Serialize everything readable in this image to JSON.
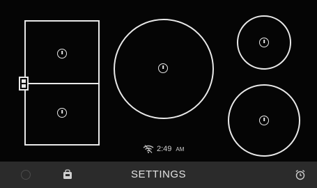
{
  "status": {
    "time": "2:49",
    "ampm": "AM"
  },
  "bottom_bar": {
    "settings_label": "SETTINGS"
  },
  "icons": {
    "zone_power": "power-icon",
    "bridge_toggle": "bridge-toggle-icon",
    "wifi": "wifi-off-icon",
    "lock": "lock-icon",
    "bag": "bag-icon",
    "alarm": "alarm-clock-icon"
  }
}
